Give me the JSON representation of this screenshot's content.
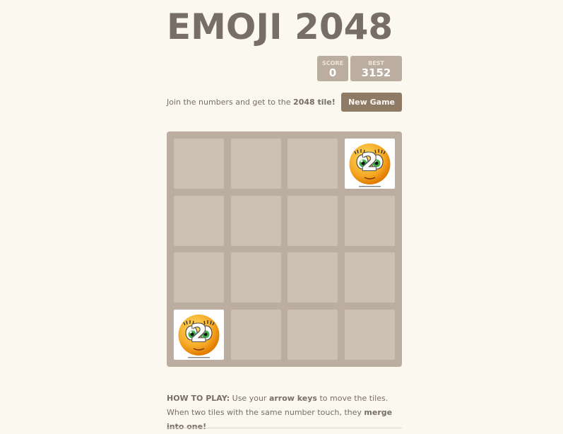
{
  "header": {
    "title": "EMOJI 2048"
  },
  "scores": {
    "score_label": "SCORE",
    "score_value": "0",
    "best_label": "BEST",
    "best_value": "3152"
  },
  "intro": {
    "text_before": "Join the numbers and get to the ",
    "text_bold": "2048 tile!",
    "new_game_label": "New Game"
  },
  "board": {
    "grid": [
      [
        null,
        null,
        null,
        2
      ],
      [
        null,
        null,
        null,
        null
      ],
      [
        null,
        null,
        null,
        null
      ],
      [
        2,
        null,
        null,
        null
      ]
    ],
    "tile_icon": "smiley-face-icon",
    "tile_2_label": "2"
  },
  "how_to_play": {
    "heading": "HOW TO PLAY:",
    "part1": " Use your ",
    "arrow_keys": "arrow keys",
    "part2": " to move the tiles. When two tiles with the same number touch, they ",
    "merge": "merge into one!"
  },
  "colors": {
    "background": "#faf8ef",
    "board": "#bbada0",
    "cell": "#cdc1b4",
    "button": "#8f7a66",
    "text": "#776e65"
  }
}
